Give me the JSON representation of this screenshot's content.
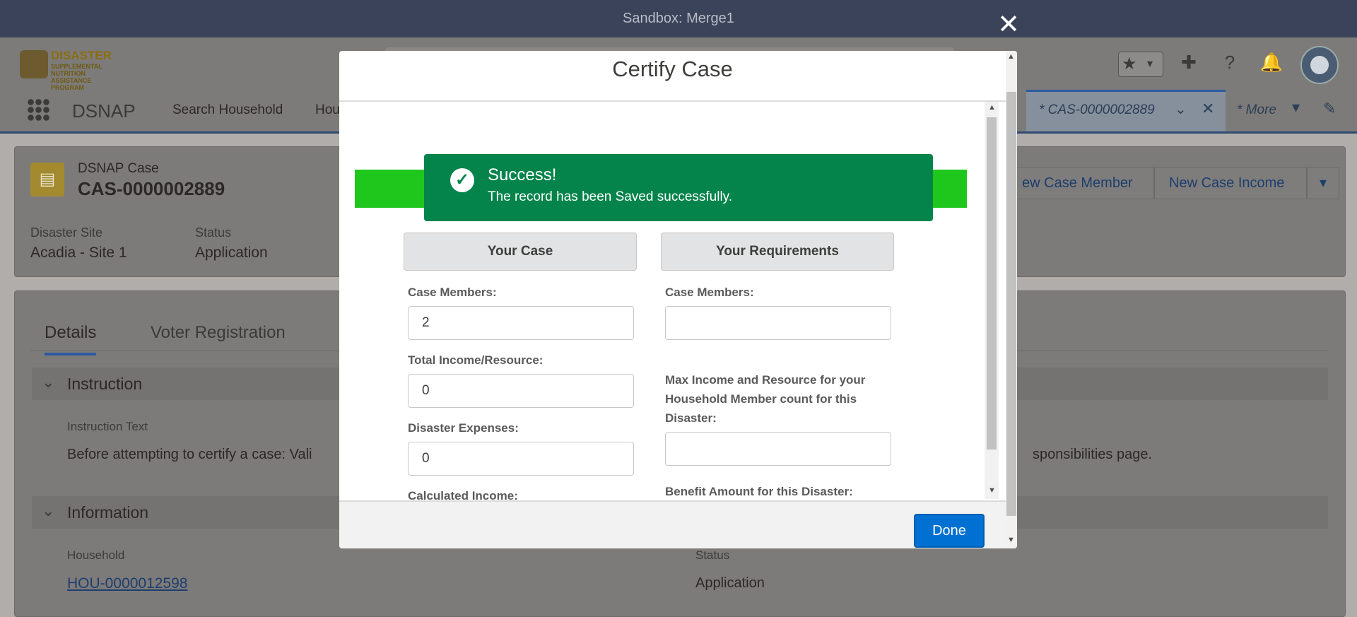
{
  "sandbox_label": "Sandbox: Merge1",
  "logo": {
    "line1": "DISASTER",
    "line2": "SUPPLEMENTAL NUTRITION",
    "line3": "ASSISTANCE PROGRAM"
  },
  "nav": {
    "app_name": "DSNAP",
    "items": [
      "Search Household",
      "Hou"
    ],
    "active_tab": "* CAS-0000002889",
    "more": "* More"
  },
  "record": {
    "type": "DSNAP Case",
    "name": "CAS-0000002889",
    "fields": [
      {
        "label": "Disaster Site",
        "value": "Acadia - Site 1"
      },
      {
        "label": "Status",
        "value": "Application"
      }
    ],
    "buttons": [
      "ew Case Member",
      "New Case Income"
    ]
  },
  "detail": {
    "tabs": [
      "Details",
      "Voter Registration"
    ],
    "sections": [
      {
        "title": "Instruction"
      },
      {
        "title": "Information"
      }
    ],
    "instruction_label": "Instruction Text",
    "instruction_text_left": "Before attempting to certify a case: Vali",
    "instruction_text_right": "sponsibilities page.",
    "household_label": "Household",
    "household_value": "HOU-0000012598",
    "status_label": "Status",
    "status_value": "Application"
  },
  "modal": {
    "title": "Certify Case",
    "toast": {
      "title": "Success!",
      "message": "The record has been Saved successfully."
    },
    "your_case": {
      "heading": "Your Case",
      "fields": [
        {
          "label": "Case Members:",
          "value": "2"
        },
        {
          "label": "Total Income/Resource:",
          "value": "0"
        },
        {
          "label": "Disaster Expenses:",
          "value": "0"
        },
        {
          "label": "Calculated Income:",
          "value": ""
        }
      ]
    },
    "your_requirements": {
      "heading": "Your Requirements",
      "fields": [
        {
          "label": "Case Members:",
          "value": ""
        },
        {
          "label": "Max Income and Resource for your Household Member count for this Disaster:",
          "value": ""
        },
        {
          "label": "Benefit Amount for this Disaster:",
          "value": ""
        }
      ]
    },
    "done_label": "Done"
  },
  "colors": {
    "success_green": "#04844b",
    "bar_green": "#1fc71d",
    "brand_blue": "#0070d2"
  }
}
